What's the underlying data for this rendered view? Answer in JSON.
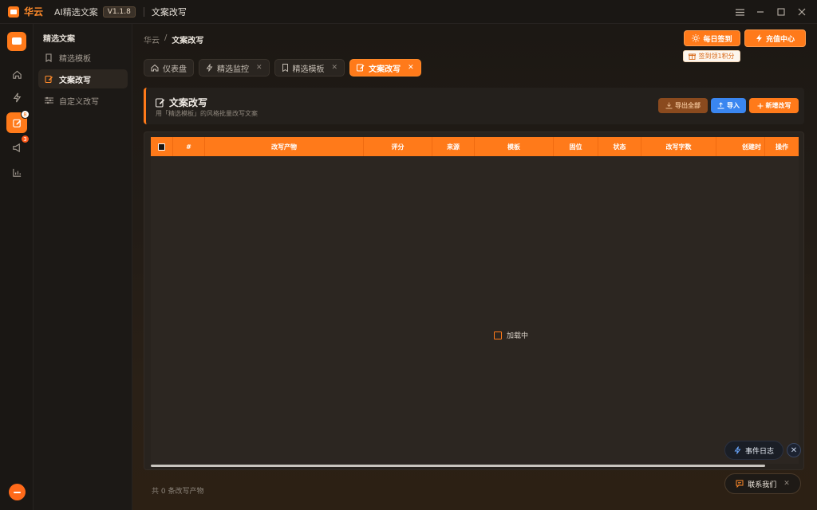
{
  "titlebar": {
    "brand": "华云",
    "app_name": "AI精选文案",
    "version": "V1.1.8",
    "page": "文案改写"
  },
  "rail": {
    "items": [
      {
        "name": "home",
        "icon": "home-icon"
      },
      {
        "name": "monitor",
        "icon": "bolt-icon"
      },
      {
        "name": "rewrite",
        "icon": "edit-icon",
        "badge": "8",
        "active": true
      },
      {
        "name": "broadcast",
        "icon": "megaphone-icon",
        "badge": "3"
      },
      {
        "name": "stats",
        "icon": "chart-icon"
      }
    ]
  },
  "subnav": {
    "title": "精选文案",
    "items": [
      {
        "label": "精选模板",
        "icon": "bookmark-icon"
      },
      {
        "label": "文案改写",
        "icon": "edit-icon",
        "active": true
      },
      {
        "label": "自定义改写",
        "icon": "sliders-icon"
      }
    ]
  },
  "header": {
    "breadcrumb_root": "华云",
    "breadcrumb_sep": "/",
    "breadcrumb_current": "文案改写",
    "checkin_label": "每日签到",
    "recharge_label": "充值中心",
    "checkin_tip": "签到领1积分"
  },
  "tabs": [
    {
      "label": "仪表盘",
      "icon": "home-icon",
      "closable": false
    },
    {
      "label": "精选监控",
      "icon": "bolt-icon",
      "closable": true
    },
    {
      "label": "精选模板",
      "icon": "bookmark-icon",
      "closable": true
    },
    {
      "label": "文案改写",
      "icon": "edit-icon",
      "closable": true,
      "active": true
    }
  ],
  "panel": {
    "title": "文案改写",
    "subtitle": "用「精选模板」的风格批量改写文案",
    "export_label": "导出全部",
    "import_label": "导入",
    "new_label": "新增改写"
  },
  "table": {
    "columns": [
      "#",
      "改写产物",
      "评分",
      "来源",
      "模板",
      "固位",
      "状态",
      "改写字数",
      "创建时",
      "操作"
    ],
    "loading_text": "加载中",
    "footer": "共 0 条改写产物"
  },
  "floating": {
    "event_log": "事件日志",
    "contact": "联系我们"
  },
  "colors": {
    "accent": "#ff7a1a",
    "background": "#141210",
    "import_blue": "#3a86f0"
  }
}
